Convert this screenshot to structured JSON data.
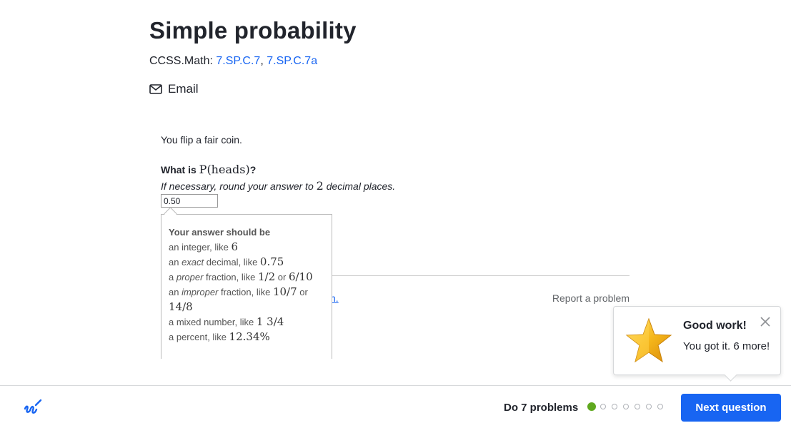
{
  "page": {
    "title": "Simple probability",
    "standards_prefix": "CCSS.Math: ",
    "standards": [
      "7.SP.C.7",
      "7.SP.C.7a"
    ],
    "standards_sep": ", ",
    "email_label": "Email"
  },
  "question": {
    "intro": "You flip a fair coin.",
    "prompt_label": "What is ",
    "prompt_math": "P(heads)",
    "prompt_end": "?",
    "hint_before": "If necessary, round your answer to ",
    "hint_math": "2",
    "hint_after": " decimal places.",
    "answer_value": "0.50"
  },
  "answer_format_tooltip": {
    "title": "Your answer should be",
    "lines": [
      {
        "pre": "an integer, like ",
        "em": "",
        "post": "",
        "math1": "6",
        "or": "",
        "math2": ""
      },
      {
        "pre": "an ",
        "em": "exact",
        "post": " decimal, like ",
        "math1": "0.75",
        "or": "",
        "math2": ""
      },
      {
        "pre": "a ",
        "em": "proper",
        "post": " fraction, like ",
        "math1": "1/2",
        "or": " or ",
        "math2": "6/10"
      },
      {
        "pre": "an ",
        "em": "improper",
        "post": " fraction, like ",
        "math1": "10/7",
        "or": " or ",
        "math2": "14/8"
      },
      {
        "pre": "a mixed number, like ",
        "em": "",
        "post": "",
        "math1": "1 3/4",
        "or": "",
        "math2": ""
      },
      {
        "pre": "a percent, like ",
        "em": "",
        "post": "",
        "math1": "12.34%",
        "or": "",
        "math2": ""
      }
    ]
  },
  "below_question": {
    "partial_link": "n.",
    "report_label": "Report a problem"
  },
  "toast": {
    "title": "Good work!",
    "message": "You got it. 6 more!",
    "icon": "star-icon"
  },
  "footer": {
    "do_label": "Do 7 problems",
    "progress": {
      "completed": 1,
      "total": 7
    },
    "next_label": "Next question",
    "logo_icon": "scratchpad-logo-icon"
  },
  "colors": {
    "accent": "#1865f2",
    "success": "#5fa81e",
    "text": "#21242c"
  }
}
